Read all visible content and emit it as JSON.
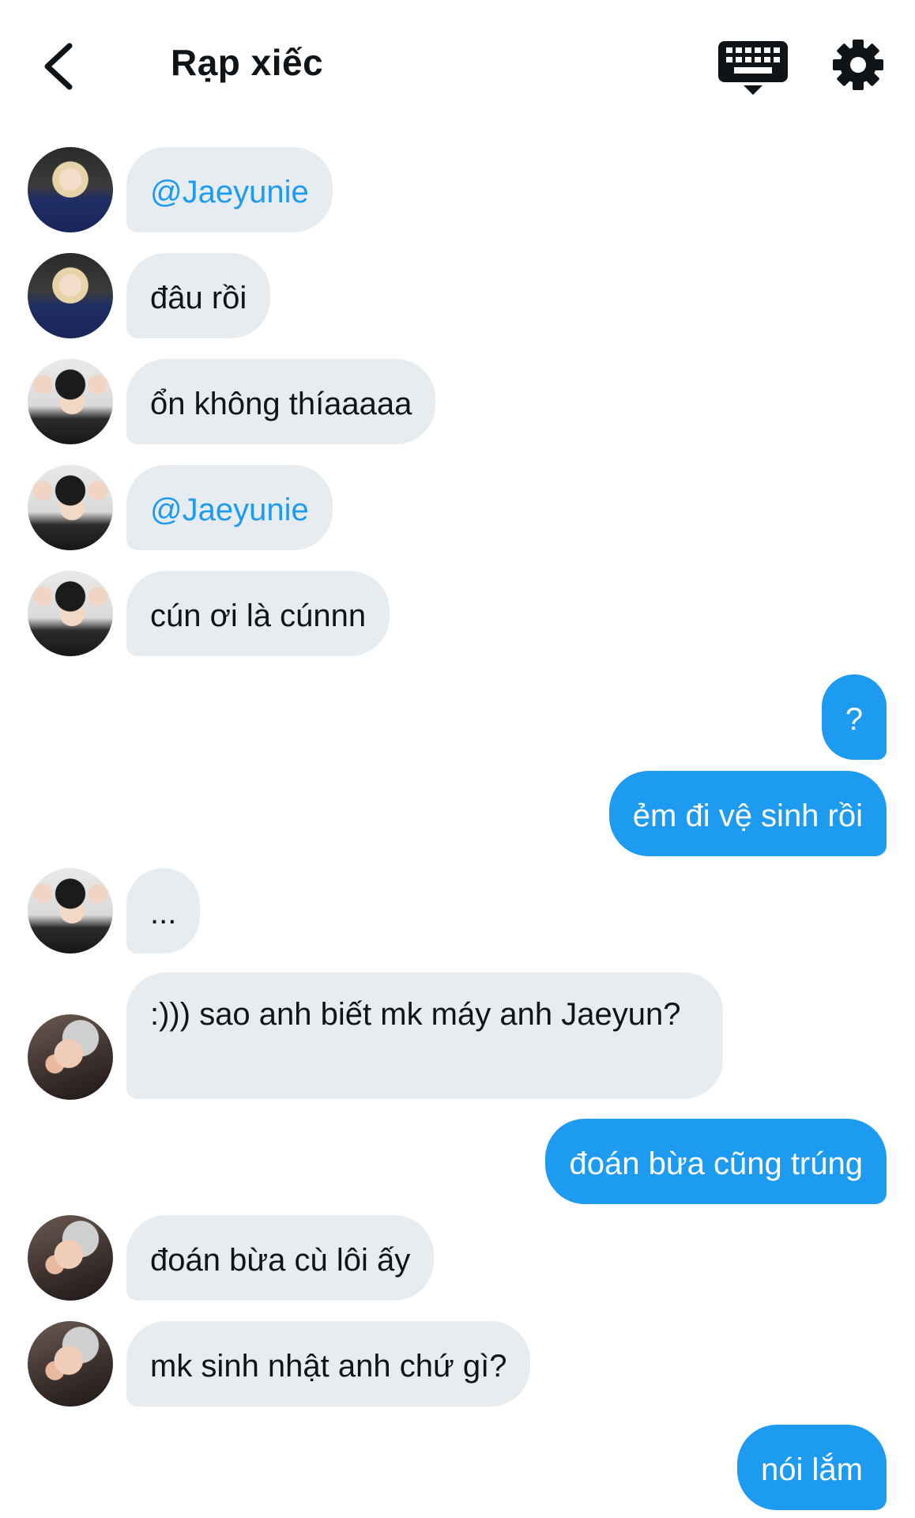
{
  "header": {
    "title": "Rạp xiếc",
    "back_icon": "chevron-left-icon",
    "keyboard_icon": "keyboard-icon",
    "settings_icon": "gear-icon"
  },
  "colors": {
    "accent": "#1d9bf0",
    "incoming_bubble": "#e7ecf0",
    "text": "#0f1419"
  },
  "messages": [
    {
      "dir": "in",
      "avatar": "user-a",
      "text": "@Jaeyunie",
      "mention": true
    },
    {
      "dir": "in",
      "avatar": "user-a",
      "text": "đâu rồi"
    },
    {
      "dir": "in",
      "avatar": "user-b",
      "text": "ổn không thíaaaaa"
    },
    {
      "dir": "in",
      "avatar": "user-b",
      "text": "@Jaeyunie",
      "mention": true
    },
    {
      "dir": "in",
      "avatar": "user-b",
      "text": "cún ơi là cúnnn"
    },
    {
      "dir": "out",
      "text": "?"
    },
    {
      "dir": "out",
      "text": "ẻm đi vệ sinh rồi"
    },
    {
      "dir": "in",
      "avatar": "user-b",
      "text": "..."
    },
    {
      "dir": "in",
      "avatar": "user-c",
      "text": ":))) sao anh biết mk máy anh Jaeyun?"
    },
    {
      "dir": "out",
      "text": "đoán bừa cũng trúng"
    },
    {
      "dir": "in",
      "avatar": "user-c",
      "text": "đoán bừa cù lôi ấy"
    },
    {
      "dir": "in",
      "avatar": "user-c",
      "text": "mk sinh nhật anh chứ gì?"
    },
    {
      "dir": "out",
      "text": "nói lắm"
    }
  ]
}
